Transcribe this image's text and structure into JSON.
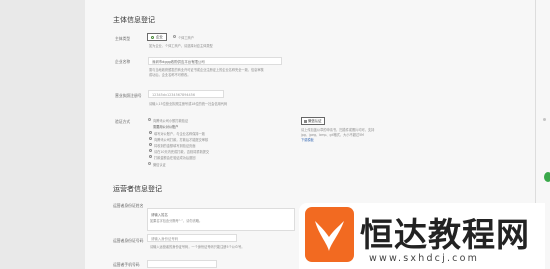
{
  "section1": {
    "title": "主体信息登记",
    "subject_type_label": "主体类型",
    "subject_type_selected": "企业",
    "subject_type_other": "个体工商户",
    "subject_type_hint": "如为企业、个体工商户，请选择对应主体类型",
    "company_name_label": "企业名称",
    "company_name_value": "深圳市dggg收购供应平台有限公司",
    "company_name_hint_1": "需与当地政府颁发的商业许可证书或企业注册证上的企业名称完全一致，信息审核",
    "company_name_hint_2": "成功后，企业名称不可修改。",
    "license_label": "营业执照注册号",
    "license_value": "12345dv1234567894456",
    "license_hint": "请输入15位营业执照注册号或18位的统一社会信用代码",
    "verify_label": "验证方式",
    "verify_option_1": "向腾讯公司小额打款验证",
    "verify_option_1_sub": "需要用公对公账户",
    "verify_steps": [
      "填写对公账户，与企业名称保持一致",
      "向腾讯公司打款，打款后才能提交审核",
      "将收到的金额填写到验证页面",
      "请在10天内完成打款，否则将重新提交",
      "打款金额会在验证成功后退回"
    ],
    "verify_option_2": "微信认证",
    "upload_label": "微信认证",
    "upload_hint_1": "请上传加盖公章的申请书，扫描件或照片均可，支持",
    "upload_hint_2": "jpg、jpeg、bmp、gif格式，大小不超过5M",
    "upload_link": "下载模板"
  },
  "section2": {
    "title": "运营者信息登记",
    "operator_name_label": "运营者身份证姓名",
    "operator_name_value": "请输入姓名",
    "operator_name_hint": "如果名字包含分隔号“·”，请勿省略。",
    "operator_id_label": "运营者身份证号码",
    "operator_id_value": "请输入身份证号码",
    "operator_id_hint": "请输入运营者的身份证号码，一个身份证号码只能注册5个公众号。",
    "phone_label": "运营者手机号码"
  },
  "watermark": {
    "title": "恒达教程网",
    "url": "www.sxhdcj.com"
  }
}
